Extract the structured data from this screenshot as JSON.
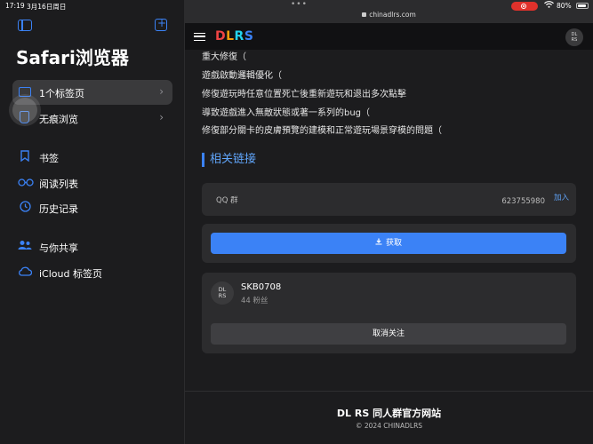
{
  "status_bar": {
    "time": "17:19",
    "date": "3月16日周日",
    "more": "•••",
    "battery": "80%"
  },
  "sidebar": {
    "title": "Safari浏览器",
    "groups": [
      {
        "label": "1个标签页",
        "icon": "tabs-icon"
      },
      {
        "label": "无痕浏览",
        "icon": "private-hand-icon"
      }
    ],
    "items": [
      {
        "label": "书签",
        "icon": "bookmark-icon"
      },
      {
        "label": "阅读列表",
        "icon": "glasses-icon"
      },
      {
        "label": "历史记录",
        "icon": "clock-icon"
      },
      {
        "label": "与你共享",
        "icon": "people-icon"
      },
      {
        "label": "iCloud 标签页",
        "icon": "cloud-icon"
      }
    ]
  },
  "browser": {
    "url": "chinadlrs.com"
  },
  "site": {
    "logo": {
      "d": "D",
      "l": "L",
      "r": "R",
      "s": "S"
    },
    "avatar_text": {
      "top": "DL",
      "bottom": "RS"
    },
    "lines": [
      "重大修復（",
      "遊戲啟動邏輯優化（",
      "修復遊玩時任意位置死亡後重新遊玩和退出多次點擊",
      "導致遊戲進入無敵狀態或著一系列的bug（",
      "修復部分關卡的皮膚預覽的建模和正常遊玩場景穿模的問題（"
    ],
    "section_title": "相关链接",
    "qq": {
      "label": "QQ 群",
      "number": "623755980",
      "join": "加入"
    },
    "download_button": "获取",
    "user": {
      "avatar_top": "DL",
      "avatar_bottom": "RS",
      "name": "SKB0708",
      "fans": "44 粉丝",
      "unfollow": "取消关注"
    },
    "footer": {
      "title": "DL RS 同人群官方网站",
      "copyright": "© 2024 CHINADLRS"
    }
  },
  "colors": {
    "accent": "#3b82f6",
    "link": "#60a5fa",
    "record": "#e0312b"
  }
}
